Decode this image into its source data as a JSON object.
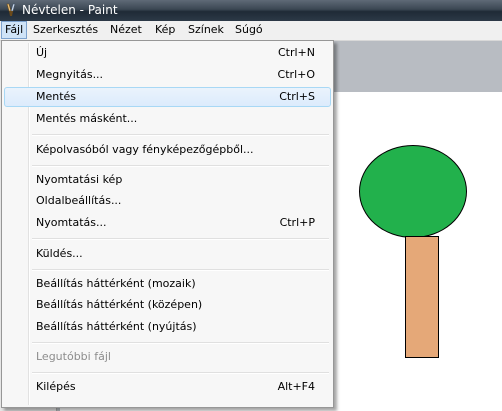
{
  "window": {
    "title": "Névtelen - Paint",
    "icon": "paint-brush-icon"
  },
  "menubar": {
    "items": [
      {
        "label": "Fájl",
        "active": true
      },
      {
        "label": "Szerkesztés"
      },
      {
        "label": "Nézet"
      },
      {
        "label": "Kép"
      },
      {
        "label": "Színek"
      },
      {
        "label": "Súgó"
      }
    ]
  },
  "file_menu": {
    "items": [
      {
        "label": "Új",
        "shortcut": "Ctrl+N"
      },
      {
        "label": "Megnyitás...",
        "shortcut": "Ctrl+O"
      },
      {
        "label": "Mentés",
        "shortcut": "Ctrl+S",
        "highlighted": true
      },
      {
        "label": "Mentés másként...",
        "shortcut": ""
      },
      {
        "label": "Képolvasóból vagy fényképezőgépből...",
        "shortcut": ""
      },
      {
        "label": "Nyomtatási kép",
        "shortcut": ""
      },
      {
        "label": "Oldalbeállítás...",
        "shortcut": ""
      },
      {
        "label": "Nyomtatás...",
        "shortcut": "Ctrl+P"
      },
      {
        "label": "Küldés...",
        "shortcut": ""
      },
      {
        "label": "Beállítás háttérként (mozaik)",
        "shortcut": ""
      },
      {
        "label": "Beállítás háttérként (középen)",
        "shortcut": ""
      },
      {
        "label": "Beállítás háttérként (nyújtás)",
        "shortcut": ""
      },
      {
        "label": "Legutóbbi fájl",
        "shortcut": "",
        "disabled": true
      },
      {
        "label": "Kilépés",
        "shortcut": "Alt+F4"
      }
    ]
  },
  "colors": {
    "tree_crown": "#22b14c",
    "tree_trunk": "#e5a878",
    "menu_highlight": "#dcebfc"
  }
}
